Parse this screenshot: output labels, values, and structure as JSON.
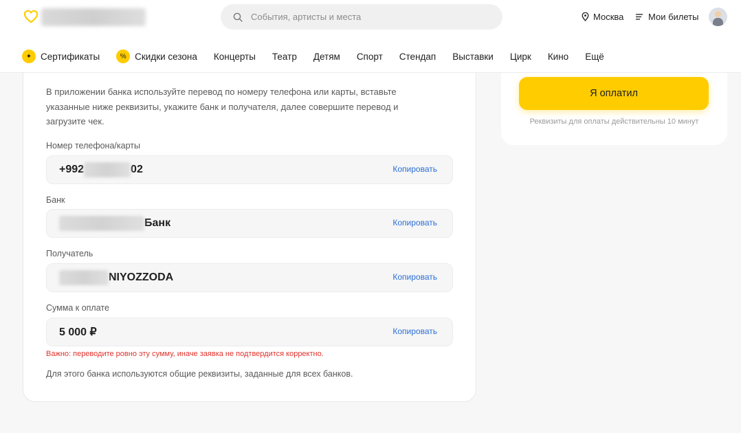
{
  "header": {
    "search": {
      "placeholder": "События, артисты и места"
    },
    "city": "Москва",
    "tickets_label": "Мои билеты"
  },
  "nav": {
    "items": [
      {
        "label": "Сертификаты",
        "badge": "✦"
      },
      {
        "label": "Скидки сезона",
        "badge": "%"
      },
      {
        "label": "Концерты"
      },
      {
        "label": "Театр"
      },
      {
        "label": "Детям"
      },
      {
        "label": "Спорт"
      },
      {
        "label": "Стендап"
      },
      {
        "label": "Выставки"
      },
      {
        "label": "Цирк"
      },
      {
        "label": "Кино"
      },
      {
        "label": "Ещё"
      }
    ]
  },
  "payment": {
    "instructions": "В приложении банка используйте перевод по номеру телефона или карты, вставьте указанные ниже реквизиты, укажите банк и получателя, далее совершите перевод и загрузите чек.",
    "fields": {
      "phone": {
        "label": "Номер телефона/карты",
        "prefix": "+992",
        "suffix": "02"
      },
      "bank": {
        "label": "Банк",
        "suffix": "Банк"
      },
      "recipient": {
        "label": "Получатель",
        "suffix": "NIYOZZODA"
      },
      "amount": {
        "label": "Сумма к оплате",
        "value": "5 000 ₽"
      }
    },
    "copy_label": "Копировать",
    "warning": "Важно: переводите ровно эту сумму, иначе заявка не подтвердится корректно.",
    "note": "Для этого банка используются общие реквизиты, заданные для всех банков."
  },
  "sidebar": {
    "pay_button": "Я оплатил",
    "validity": "Реквизиты для оплаты действительны 10 минут"
  },
  "colors": {
    "accent": "#ffcc00",
    "link": "#2b6fd6",
    "warning": "#e0322b"
  }
}
